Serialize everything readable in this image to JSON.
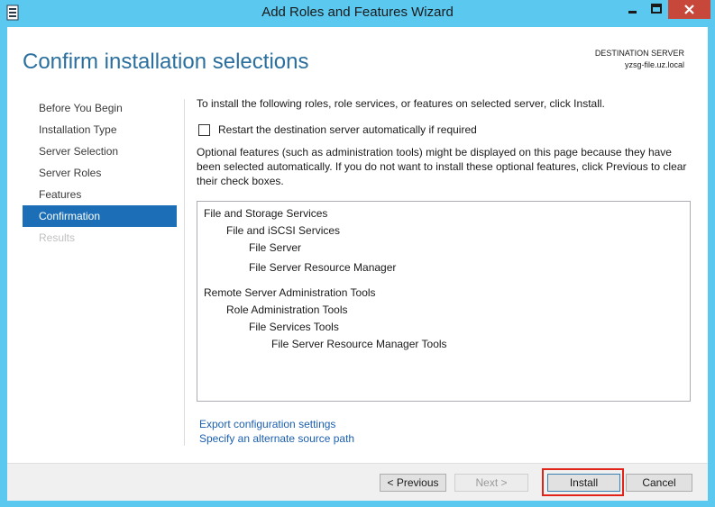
{
  "window": {
    "title": "Add Roles and Features Wizard"
  },
  "header": {
    "heading": "Confirm installation selections",
    "destination_label": "DESTINATION SERVER",
    "destination_value": "yzsg-file.uz.local"
  },
  "nav": {
    "items": [
      {
        "label": "Before You Begin",
        "state": "normal"
      },
      {
        "label": "Installation Type",
        "state": "normal"
      },
      {
        "label": "Server Selection",
        "state": "normal"
      },
      {
        "label": "Server Roles",
        "state": "normal"
      },
      {
        "label": "Features",
        "state": "normal"
      },
      {
        "label": "Confirmation",
        "state": "active"
      },
      {
        "label": "Results",
        "state": "disabled"
      }
    ]
  },
  "main": {
    "intro": "To install the following roles, role services, or features on selected server, click Install.",
    "restart_label": "Restart the destination server automatically if required",
    "restart_checked": false,
    "optional_note": "Optional features (such as administration tools) might be displayed on this page because they have been selected automatically. If you do not want to install these optional features, click Previous to clear their check boxes.",
    "features": [
      {
        "text": "File and Storage Services",
        "level": 0
      },
      {
        "text": "File and iSCSI Services",
        "level": 1
      },
      {
        "text": "File Server",
        "level": 2
      },
      {
        "text": "File Server Resource Manager",
        "level": 2
      },
      {
        "text": "Remote Server Administration Tools",
        "level": 0
      },
      {
        "text": "Role Administration Tools",
        "level": 1
      },
      {
        "text": "File Services Tools",
        "level": 2
      },
      {
        "text": "File Server Resource Manager Tools",
        "level": 3
      }
    ],
    "links": {
      "export": "Export configuration settings",
      "alternate_source": "Specify an alternate source path"
    }
  },
  "footer": {
    "previous": "< Previous",
    "next": "Next >",
    "install": "Install",
    "cancel": "Cancel"
  },
  "colors": {
    "titlebar": "#5bc8f0",
    "accent": "#1c6fb7",
    "heading": "#2a6f9e",
    "highlight": "#e2231a"
  }
}
